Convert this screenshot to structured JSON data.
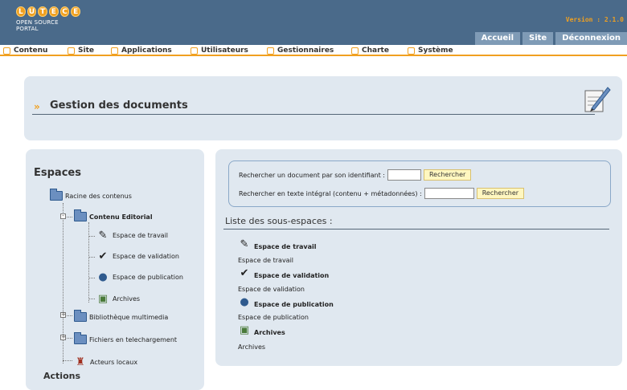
{
  "header": {
    "logo_letters": [
      "L",
      "U",
      "T",
      "E",
      "C",
      "E"
    ],
    "logo_subtitle": "OPEN SOURCE PORTAL",
    "version": "Version : 2.1.0",
    "nav": [
      "Accueil",
      "Site",
      "Déconnexion"
    ]
  },
  "menu": [
    "Contenu",
    "Site",
    "Applications",
    "Utilisateurs",
    "Gestionnaires",
    "Charte",
    "Système"
  ],
  "page_title": "Gestion des documents",
  "left": {
    "title": "Espaces",
    "tree": {
      "root": "Racine des contenus",
      "editorial": "Contenu Editorial",
      "workspace": "Espace de travail",
      "validation": "Espace de validation",
      "publication": "Espace de publication",
      "archives": "Archives",
      "multimedia": "Bibliothèque multimedia",
      "downloads": "Fichiers en telechargement",
      "local": "Acteurs locaux"
    },
    "actions_title": "Actions"
  },
  "search": {
    "by_id_label": "Rechercher un document par son identifiant :",
    "by_id_button": "Rechercher",
    "fulltext_label": "Rechercher en texte intégral (contenu + métadonnées) :",
    "fulltext_button": "Rechercher"
  },
  "subspaces": {
    "title": "Liste des sous-espaces :",
    "items": [
      {
        "name": "Espace de travail",
        "desc": "Espace de travail"
      },
      {
        "name": "Espace de validation",
        "desc": "Espace de validation"
      },
      {
        "name": "Espace de publication",
        "desc": "Espace de publication"
      },
      {
        "name": "Archives",
        "desc": "Archives"
      }
    ]
  },
  "colors": {
    "header": "#4a6a8a",
    "accent": "#f0a020",
    "panel": "#e0e8f0",
    "button": "#fff7c0"
  }
}
